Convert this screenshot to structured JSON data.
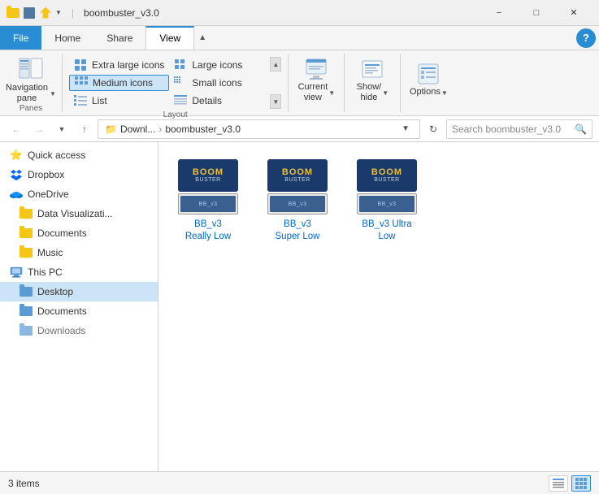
{
  "window": {
    "title": "boombuster_v3.0",
    "controls": {
      "minimize": "−",
      "maximize": "□",
      "close": "✕"
    }
  },
  "ribbon": {
    "tabs": [
      "File",
      "Home",
      "Share",
      "View"
    ],
    "active_tab": "View",
    "help": "?",
    "groups": {
      "panes": {
        "label": "Panes",
        "nav_pane": "Navigation\npane"
      },
      "layout": {
        "label": "Layout",
        "items": [
          {
            "label": "Extra large icons",
            "selected": false
          },
          {
            "label": "Large icons",
            "selected": false
          },
          {
            "label": "Medium icons",
            "selected": true
          },
          {
            "label": "Small icons",
            "selected": false
          },
          {
            "label": "List",
            "selected": false
          },
          {
            "label": "Details",
            "selected": false
          }
        ]
      },
      "current_view": {
        "label": "Current\nview"
      },
      "show_hide": {
        "label": "Show/\nhide"
      },
      "options": {
        "label": "Options"
      }
    }
  },
  "address_bar": {
    "back_enabled": false,
    "forward_enabled": false,
    "up_enabled": true,
    "path_parts": [
      "Downl...",
      "boombuster_v3.0"
    ],
    "path_separator": "›",
    "search_placeholder": "Search boombuster_v3.0"
  },
  "sidebar": {
    "items": [
      {
        "label": "Quick access",
        "icon": "star",
        "indent": 0
      },
      {
        "label": "Dropbox",
        "icon": "dropbox",
        "indent": 0
      },
      {
        "label": "OneDrive",
        "icon": "onedrive",
        "indent": 0
      },
      {
        "label": "Data Visualizati...",
        "icon": "folder",
        "indent": 1
      },
      {
        "label": "Documents",
        "icon": "folder",
        "indent": 1
      },
      {
        "label": "Music",
        "icon": "folder",
        "indent": 1
      },
      {
        "label": "This PC",
        "icon": "computer",
        "indent": 0
      },
      {
        "label": "Desktop",
        "icon": "folder-blue",
        "indent": 1,
        "selected": true
      },
      {
        "label": "Documents",
        "icon": "folder-blue",
        "indent": 1
      },
      {
        "label": "Downloads",
        "icon": "folder-blue",
        "indent": 1,
        "partial": true
      }
    ]
  },
  "files": [
    {
      "name": "BB_v3\nReally Low",
      "type": "folder"
    },
    {
      "name": "BB_v3\nSuper Low",
      "type": "folder"
    },
    {
      "name": "BB_v3 Ultra\nLow",
      "type": "folder"
    }
  ],
  "status": {
    "item_count": "3 items",
    "items_label": "items"
  }
}
